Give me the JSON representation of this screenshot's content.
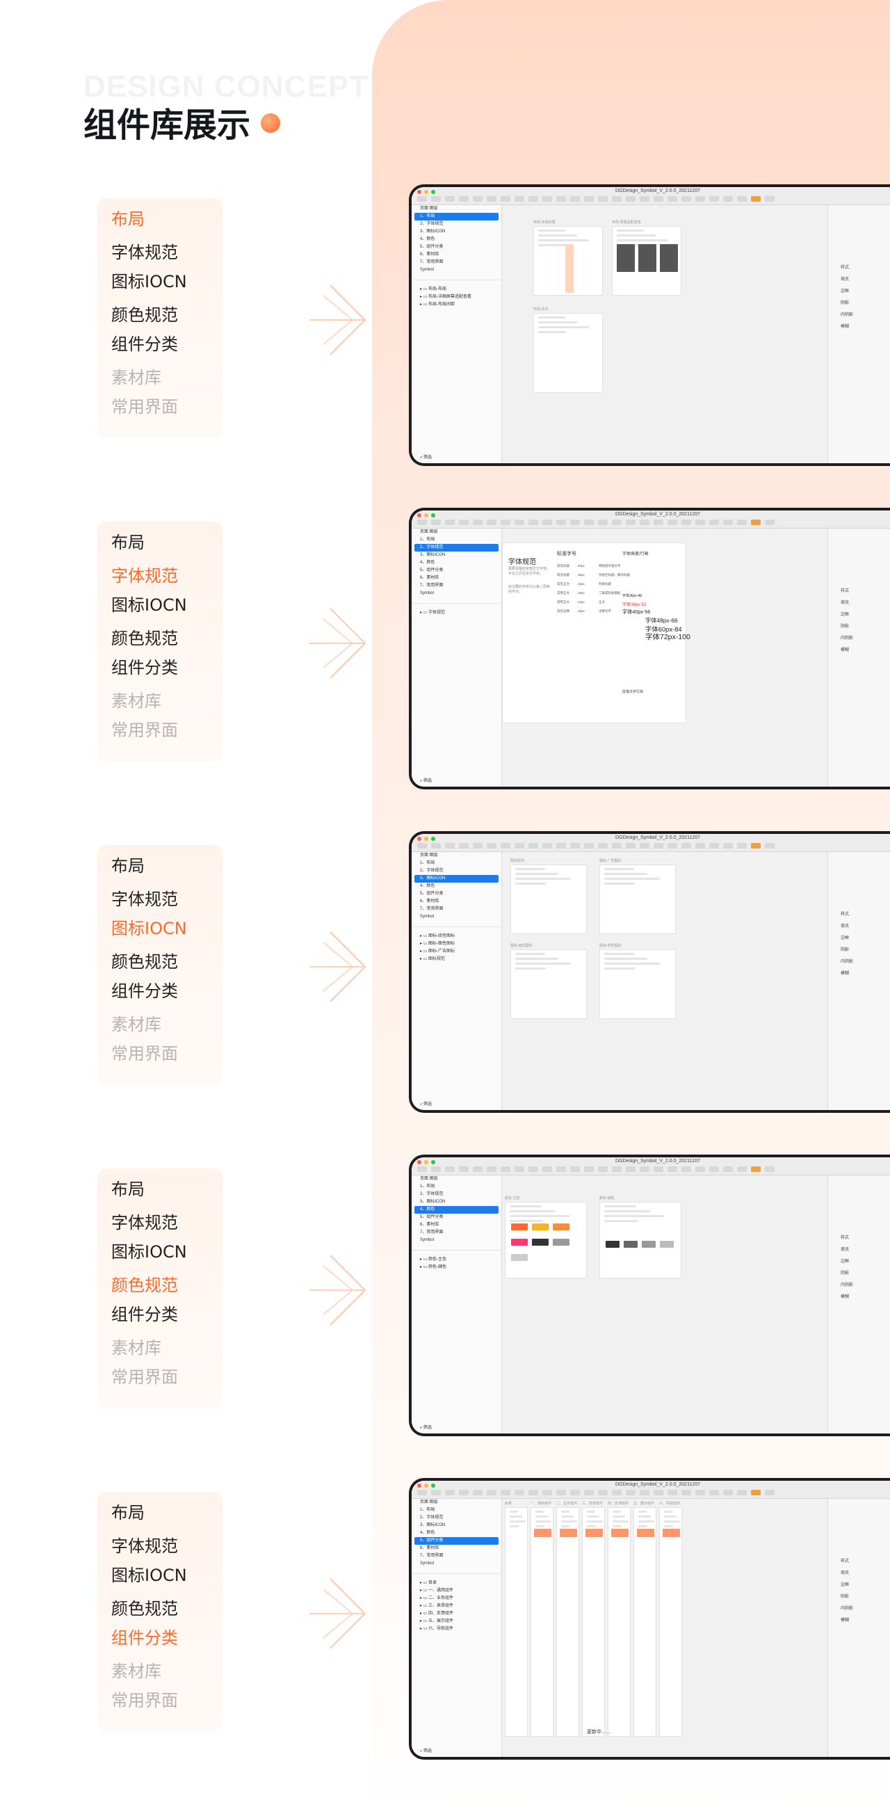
{
  "header": {
    "ghost_title": "DESIGN CONCEPT",
    "title": "组件库展示"
  },
  "menu": {
    "items": [
      "布局",
      "字体规范",
      "图标IOCN",
      "颜色规范",
      "组件分类",
      "素材库",
      "常用界面"
    ]
  },
  "app": {
    "doc_title": "DGDesign_Symbol_V_2.0.0_20211207",
    "sidebar_tabs": [
      "页面",
      "图层"
    ],
    "pages": [
      "1、布局",
      "2、字体规范",
      "3、图标ICON",
      "4、颜色",
      "5、组件分类",
      "6、素材库",
      "7、常用界面",
      "Symbol"
    ],
    "inspector": [
      "样式",
      "填充",
      "边框",
      "阴影",
      "内阴影",
      "模糊"
    ],
    "search_placeholder": "筛选"
  },
  "sections": [
    {
      "active_index": 0,
      "layers": [
        "布局-布局",
        "布局-详细屏幕适配查看",
        "布局-布局间距"
      ],
      "artboard_labels": [
        "布局-布局标题",
        "布局-屏幕适配查看",
        "布局-布点"
      ]
    },
    {
      "active_index": 1,
      "layers": [
        "字体规范"
      ],
      "font_title": "字体规范",
      "font_desc": "需要清楚的全部正文字体，平台之间互定位字体。",
      "font_desc2": "标注要的字体为以第二层级的作为。",
      "size_heading": "标准字号",
      "size_rows": [
        [
          "常见标题",
          "40px",
          "特别提示类文字"
        ],
        [
          "常见标题",
          "36px",
          "导航栏标题、模块标题"
        ],
        [
          "常见正文",
          "32px",
          "列表标题"
        ],
        [
          "常用正文",
          "28px",
          "二级或列表辅助"
        ],
        [
          "常用正文",
          "24px",
          "正文"
        ],
        [
          "常见注释",
          "20px",
          "注释文字"
        ]
      ],
      "scale_heading": "字体高度/行高",
      "scale_list": [
        "字体36px-48",
        "字体38px-52",
        "字体40px-56",
        "字体48px-66",
        "字体60px-84",
        "字体72px-100"
      ],
      "bottom_heading": "段落文字行高"
    },
    {
      "active_index": 2,
      "layers": [
        "图标-线性图标",
        "图标-面性图标",
        "图标-广告图标",
        "图标规范"
      ],
      "artboard_labels": [
        "图标规范",
        "图标-广告图标",
        "图标-面性图标",
        "图标-线性图标"
      ]
    },
    {
      "active_index": 3,
      "layers": [
        "颜色-主色",
        "颜色-辅色"
      ],
      "artboard_labels": [
        "颜色-主色",
        "颜色-辅色"
      ]
    },
    {
      "active_index": 4,
      "layers": [
        "目录",
        "一、通用组件",
        "二、业务组件",
        "三、表单组件",
        "四、反馈组件",
        "五、展示组件",
        "六、导航组件"
      ],
      "artboard_labels": [
        "目录",
        "一、通用组件",
        "二、业务组件",
        "三、表单组件",
        "四、反馈组件",
        "五、展示组件",
        "六、导航组件"
      ],
      "footer_text": "更新中……"
    }
  ],
  "colors": {
    "accent": "#ff6a2a",
    "selection": "#1f7bea"
  }
}
